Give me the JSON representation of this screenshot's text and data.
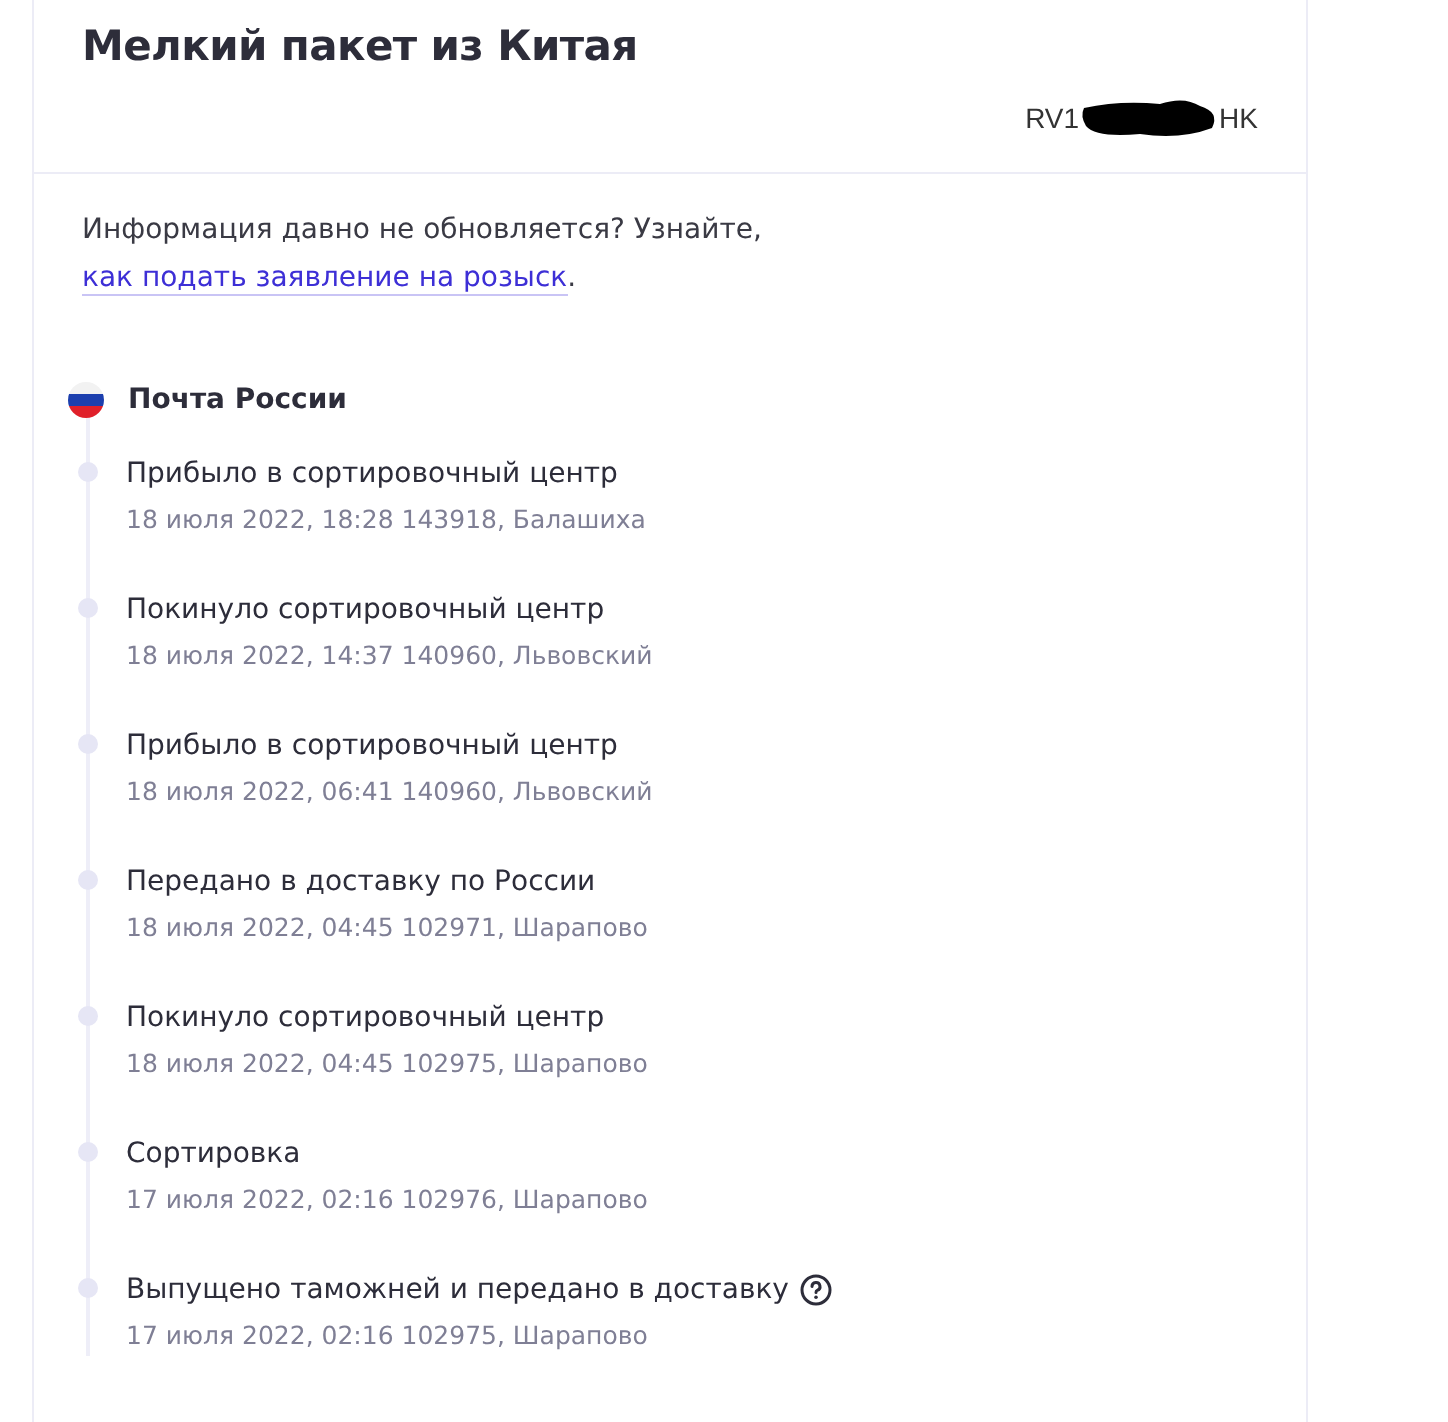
{
  "title": "Мелкий пакет из Китая",
  "tracking": {
    "visible_start": "RV1",
    "visible_end": "HK",
    "redacted": true
  },
  "notice": {
    "text": "Информация давно не обновляется? Узнайте, ",
    "link": "как подать заявление на розыск",
    "end": "."
  },
  "carrier": {
    "name": "Почта России"
  },
  "events": [
    {
      "status": "Прибыло в сортировочный центр",
      "details": "18 июля 2022, 18:28 143918, Балашиха"
    },
    {
      "status": "Покинуло сортировочный центр",
      "details": "18 июля 2022, 14:37 140960, Львовский"
    },
    {
      "status": "Прибыло в сортировочный центр",
      "details": "18 июля 2022, 06:41 140960, Львовский"
    },
    {
      "status": "Передано в доставку по России",
      "details": "18 июля 2022, 04:45 102971, Шарапово"
    },
    {
      "status": "Покинуло сортировочный центр",
      "details": "18 июля 2022, 04:45 102975, Шарапово"
    },
    {
      "status": "Сортировка",
      "details": "17 июля 2022, 02:16 102976, Шарапово"
    },
    {
      "status": "Выпущено таможней и передано в доставку",
      "details": "17 июля 2022, 02:16 102975, Шарапово",
      "help": true
    }
  ]
}
